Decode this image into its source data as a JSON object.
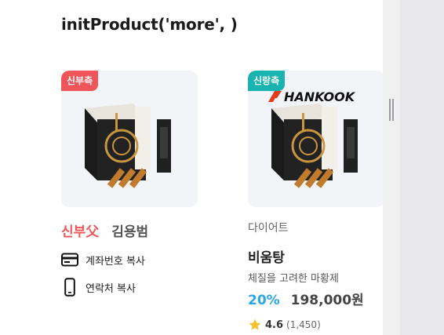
{
  "header": {
    "code_title": "initProduct('more', )"
  },
  "card1": {
    "badge": "신부측",
    "badge_color": "#f0555a",
    "role": "신부父",
    "name": "김용범",
    "actions": [
      {
        "icon": "credit-card-icon",
        "label": "계좌번호 복사"
      },
      {
        "icon": "phone-icon",
        "label": "연락처 복사"
      }
    ]
  },
  "card2": {
    "badge": "신랑측",
    "badge_color": "#19b3b0",
    "brand": "HANKOOK",
    "category": "다이어트",
    "name": "비움탕",
    "description": "체질을 고려한 마황제",
    "discount": "20%",
    "price": "198,000원",
    "rating": "4.6",
    "review_count": "(1,450)",
    "accent_color": "#2aa6e6"
  }
}
